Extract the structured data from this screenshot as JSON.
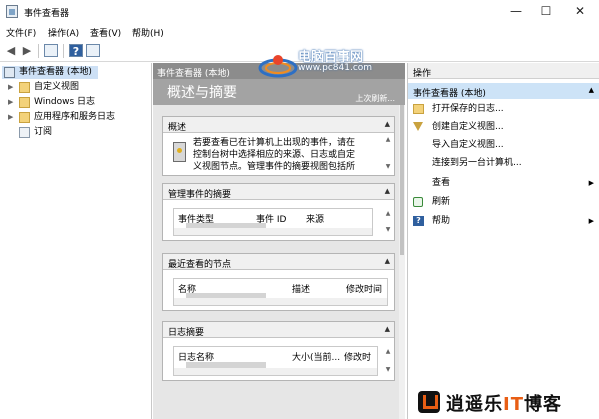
{
  "window": {
    "title": "事件查看器",
    "minimize_glyph": "—",
    "maximize_glyph": "☐",
    "close_glyph": "✕"
  },
  "menu": [
    "文件(F)",
    "操作(A)",
    "查看(V)",
    "帮助(H)"
  ],
  "toolbar": {
    "back": "◀",
    "forward": "▶",
    "help": "?"
  },
  "tree": {
    "root": "事件查看器 (本地)",
    "items": [
      "自定义视图",
      "Windows 日志",
      "应用程序和服务日志",
      "订阅"
    ]
  },
  "center": {
    "header": "事件查看器 (本地)",
    "overview_title": "概述与摘要",
    "last_refreshed": "上次刷新...",
    "sections": {
      "overview": {
        "title": "概述",
        "text_lines": [
          "若要查看已在计算机上出现的事件，请在",
          "控制台树中选择相应的来源、日志或自定",
          "义视图节点。管理事件的摘要视图包括所"
        ]
      },
      "admin_events": {
        "title": "管理事件的摘要",
        "columns": [
          "事件类型",
          "事件 ID",
          "来源"
        ]
      },
      "recent_nodes": {
        "title": "最近查看的节点",
        "columns": [
          "名称",
          "描述",
          "修改时间"
        ]
      },
      "log_summary": {
        "title": "日志摘要",
        "columns": [
          "日志名称",
          "大小(当前...",
          "修改时"
        ]
      }
    }
  },
  "actions": {
    "header": "操作",
    "group": "事件查看器 (本地)",
    "items": [
      {
        "label": "打开保存的日志...",
        "icon": "open-folder-icon"
      },
      {
        "label": "创建自定义视图...",
        "icon": "filter-icon"
      },
      {
        "label": "导入自定义视图..."
      },
      {
        "label": "连接到另一台计算机..."
      },
      {
        "label": "查看",
        "submenu": true
      },
      {
        "label": "刷新",
        "icon": "refresh-icon"
      },
      {
        "label": "帮助",
        "icon": "help-icon",
        "submenu": true
      }
    ]
  },
  "watermarks": {
    "site_name": "电脑百事网",
    "site_url": "www.pc841.com",
    "blog_pre": "逍遥乐",
    "blog_it": "IT",
    "blog_post": "博客"
  },
  "colors": {
    "accent": "#cde3f7",
    "center_header": "#8c8c8c",
    "center_bg": "#e6e6e6",
    "brand_orange": "#e85e14"
  }
}
